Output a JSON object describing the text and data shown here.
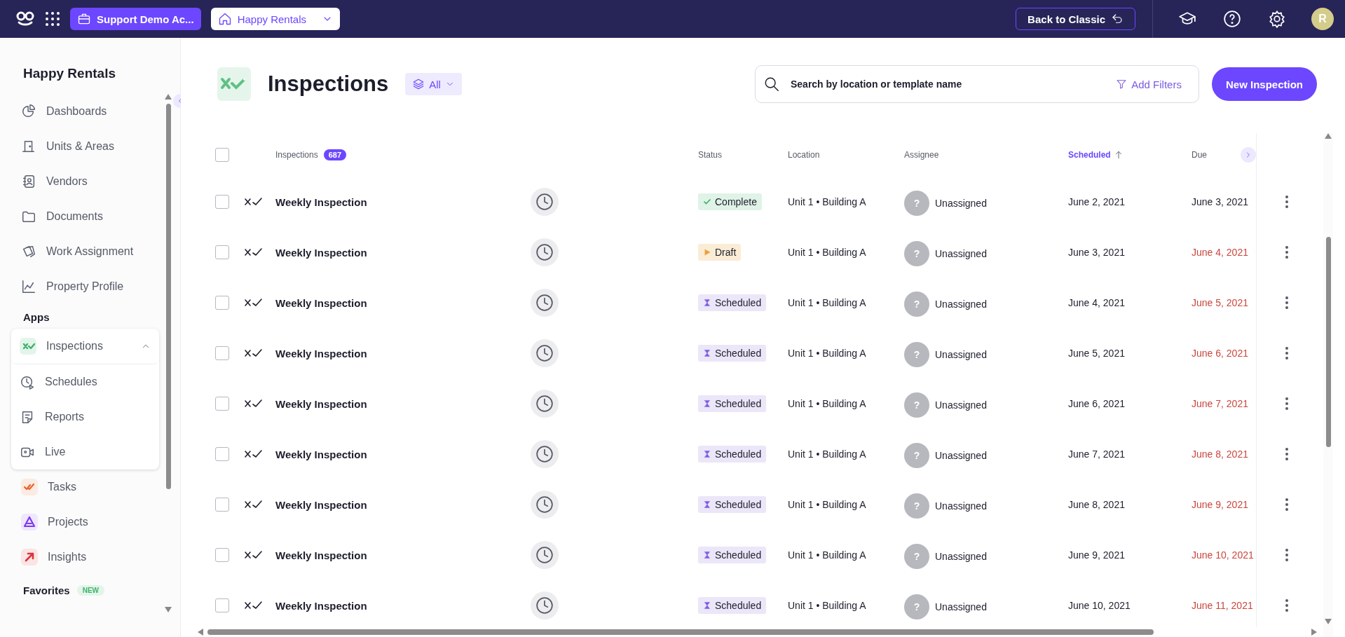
{
  "topbar": {
    "account": "Support Demo Ac...",
    "property": "Happy Rentals",
    "back_button": "Back to Classic",
    "avatar": "R"
  },
  "sidebar": {
    "title": "Happy Rentals",
    "items": [
      {
        "label": "Dashboards",
        "kind": "pie"
      },
      {
        "label": "Units & Areas",
        "kind": "door"
      },
      {
        "label": "Vendors",
        "kind": "contact"
      },
      {
        "label": "Documents",
        "kind": "folder"
      },
      {
        "label": "Work Assignment",
        "kind": "pages"
      },
      {
        "label": "Property Profile",
        "kind": "chart"
      }
    ],
    "apps_heading": "Apps",
    "apps": [
      {
        "label": "Inspections",
        "kind": "inspect",
        "expanded": true,
        "children": [
          {
            "label": "Schedules",
            "kind": "clock"
          },
          {
            "label": "Reports",
            "kind": "note"
          },
          {
            "label": "Live",
            "kind": "video"
          }
        ]
      },
      {
        "label": "Tasks",
        "kind": "tasks",
        "expanded": false
      },
      {
        "label": "Projects",
        "kind": "projects",
        "expanded": false
      },
      {
        "label": "Insights",
        "kind": "insights",
        "expanded": false
      }
    ],
    "favorites": "Favorites",
    "favorites_badge": "NEW"
  },
  "page": {
    "title": "Inspections",
    "filter": "All",
    "search": {
      "placeholder": "Search by location or template name"
    },
    "add_filters": "Add Filters",
    "new_button": "New Inspection"
  },
  "table": {
    "all_checked": false,
    "columns": [
      {
        "label": "Inspections",
        "count": "687",
        "sorted": false
      },
      {
        "label": "Status",
        "sorted": false
      },
      {
        "label": "Location",
        "sorted": false
      },
      {
        "label": "Assignee",
        "sorted": false
      },
      {
        "label": "Scheduled",
        "sorted": true
      },
      {
        "label": "Due",
        "sorted": false
      }
    ],
    "rows": [
      {
        "checked": false,
        "name": "Weekly Inspection",
        "status": "Complete",
        "kind": "complete",
        "location": "Unit 1 • Building A",
        "avatar": "?",
        "assignee": "Unassigned",
        "scheduled": "June 2, 2021",
        "due": "June 3, 2021",
        "overdue": false
      },
      {
        "checked": false,
        "name": "Weekly Inspection",
        "status": "Draft",
        "kind": "draft",
        "location": "Unit 1 • Building A",
        "avatar": "?",
        "assignee": "Unassigned",
        "scheduled": "June 3, 2021",
        "due": "June 4, 2021",
        "overdue": true
      },
      {
        "checked": false,
        "name": "Weekly Inspection",
        "status": "Scheduled",
        "kind": "scheduled",
        "location": "Unit 1 • Building A",
        "avatar": "?",
        "assignee": "Unassigned",
        "scheduled": "June 4, 2021",
        "due": "June 5, 2021",
        "overdue": true
      },
      {
        "checked": false,
        "name": "Weekly Inspection",
        "status": "Scheduled",
        "kind": "scheduled",
        "location": "Unit 1 • Building A",
        "avatar": "?",
        "assignee": "Unassigned",
        "scheduled": "June 5, 2021",
        "due": "June 6, 2021",
        "overdue": true
      },
      {
        "checked": false,
        "name": "Weekly Inspection",
        "status": "Scheduled",
        "kind": "scheduled",
        "location": "Unit 1 • Building A",
        "avatar": "?",
        "assignee": "Unassigned",
        "scheduled": "June 6, 2021",
        "due": "June 7, 2021",
        "overdue": true
      },
      {
        "checked": false,
        "name": "Weekly Inspection",
        "status": "Scheduled",
        "kind": "scheduled",
        "location": "Unit 1 • Building A",
        "avatar": "?",
        "assignee": "Unassigned",
        "scheduled": "June 7, 2021",
        "due": "June 8, 2021",
        "overdue": true
      },
      {
        "checked": false,
        "name": "Weekly Inspection",
        "status": "Scheduled",
        "kind": "scheduled",
        "location": "Unit 1 • Building A",
        "avatar": "?",
        "assignee": "Unassigned",
        "scheduled": "June 8, 2021",
        "due": "June 9, 2021",
        "overdue": true
      },
      {
        "checked": false,
        "name": "Weekly Inspection",
        "status": "Scheduled",
        "kind": "scheduled",
        "location": "Unit 1 • Building A",
        "avatar": "?",
        "assignee": "Unassigned",
        "scheduled": "June 9, 2021",
        "due": "June 10, 2021",
        "overdue": true
      },
      {
        "checked": false,
        "name": "Weekly Inspection",
        "status": "Scheduled",
        "kind": "scheduled",
        "location": "Unit 1 • Building A",
        "avatar": "?",
        "assignee": "Unassigned",
        "scheduled": "June 10, 2021",
        "due": "June 11, 2021",
        "overdue": true
      }
    ]
  }
}
